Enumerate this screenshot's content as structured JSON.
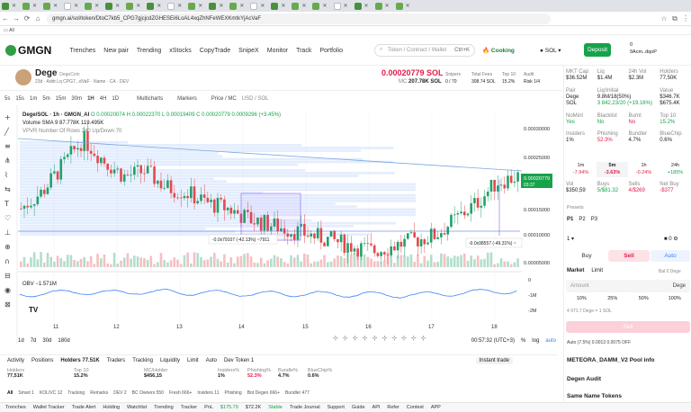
{
  "browser": {
    "url": "gmgn.ai/sol/token/DtoC7kb5_CPG7gjcjcdZGHESEi6LoAL4xqZhNFeWEXKmtkYjAcVaF",
    "bookmarks_label": "All"
  },
  "header": {
    "logo": "GMGN",
    "nav": [
      "Trenches",
      "New pair",
      "Trending",
      "xStocks",
      "CopyTrade",
      "SnipeX",
      "Monitor",
      "Track",
      "Portfolio"
    ],
    "search_placeholder": "Token / Contract / Wallet",
    "search_shortcut": "Ctrl+K",
    "cooking": "Cooking",
    "chain": "SOL",
    "deposit": "Deposit",
    "wallet_balance": "0",
    "wallet_id": "9Acm..dqoP"
  },
  "token": {
    "name": "Dege",
    "fullname": "DegeCoin",
    "age": "23d",
    "address": "Addr.Lq CPG7...dVaF",
    "links": [
      "Name",
      "CA",
      "DEV"
    ],
    "price": "0.00020779 SOL",
    "mc_label": "MC",
    "mc": "207.78K SOL",
    "stats": [
      {
        "label": "Snipers",
        "value": "0 / 70"
      },
      {
        "label": "Total Fees",
        "value": "308.74 SOL"
      },
      {
        "label": "Top 10",
        "value": "15.2%"
      },
      {
        "label": "Audit",
        "value": "Risk 1/4"
      }
    ]
  },
  "chart_toolbar": [
    "5s",
    "15s",
    "1m",
    "5m",
    "15m",
    "30m",
    "1H",
    "4H",
    "1D",
    "Multicharts",
    "Markers",
    "Price / MC",
    "USD / SOL"
  ],
  "chart_legend": {
    "title": "Dege/SOL · 1h · GMGN_AI",
    "ohlc": "O 0.00020074  H 0.00022370  L 0.00019409  C 0.00020779  0.0009296 (+3.45%)",
    "volume": "Volume SMA 9  87.778K  119.495K",
    "vpvr": "VPVR Number Of Rows 240 Up/Down 70",
    "obv": "OBV  −1.571M"
  },
  "chart_data": {
    "type": "candlestick",
    "title": "Dege/SOL · 1h",
    "x_ticks": [
      "11",
      "12",
      "13",
      "14",
      "15",
      "16",
      "17",
      "18"
    ],
    "y_ticks": [
      "0.00030000",
      "0.00025000",
      "0.00020000",
      "0.00015000",
      "0.00010000",
      "0.00005000"
    ],
    "ylim": [
      4e-05,
      0.00033
    ],
    "last_price_label": "0.00020779",
    "last_time_label": "03:37",
    "annotations": [
      "-0.0x79107 (-42.13%) ~7911",
      "-0.0x98557 (-49.31%) ~"
    ],
    "obv_ticks": [
      "0",
      "-1M",
      "-2M"
    ],
    "close_path": [
      0.00015,
      0.00018,
      0.00023,
      0.00028,
      0.00024,
      0.00021,
      0.00022,
      0.00019,
      0.00018,
      0.00016,
      0.00015,
      0.00013,
      0.00012,
      0.00011,
      0.0001,
      9e-05,
      8e-05,
      7e-05,
      8e-05,
      9e-05,
      0.0001,
      0.00013,
      0.00016,
      0.0002,
      0.00021
    ]
  },
  "chart_footer": {
    "ranges": [
      "1d",
      "7d",
      "30d",
      "180d"
    ],
    "clock": "00:57:32 (UTC+3)",
    "scale": [
      "%",
      "log",
      "auto"
    ]
  },
  "bottom": {
    "tabs": [
      "Activity",
      "Positions",
      "Holders 77.51K",
      "Traders",
      "Tracking",
      "Liquidity",
      "Limit",
      "Auto",
      "Dev Token 1"
    ],
    "instant_trade": "Instant trade",
    "stats": [
      {
        "label": "Holders",
        "value": "77,51K"
      },
      {
        "label": "Top 10",
        "value": "15.2%"
      },
      {
        "label": "MC/Holder",
        "value": "$456,15"
      },
      {
        "label": "Insiders%",
        "value": "1%"
      },
      {
        "label": "Phishing%",
        "value": "52.3%"
      },
      {
        "label": "Bundle%",
        "value": "4.7%"
      },
      {
        "label": "BlueChip%",
        "value": "0.6%"
      }
    ],
    "filters": [
      "All",
      "Smart 1",
      "KOL/VC 12",
      "Tracking",
      "Remarks",
      "DEV 2",
      "BC Owners 550",
      "Fresh 666+",
      "Insiders 11",
      "Phishing",
      "Bot Degen 666+",
      "Bundler 477"
    ]
  },
  "statusbar": [
    "Trenches",
    "Wallet Tracker",
    "Trade Alert",
    "Holding",
    "Watchlist",
    "Trending",
    "Tracker",
    "PnL",
    "$175.79",
    "$72.2K",
    "Stable",
    "Trade Journal",
    "Support",
    "Guide",
    "API",
    "Refer",
    "Contest",
    "APP"
  ],
  "right": {
    "metrics_row1": [
      {
        "l": "MKT Cap",
        "v": "$36.52M"
      },
      {
        "l": "Liq",
        "v": "$1.4M"
      },
      {
        "l": "24h Vol",
        "v": "$2.3M"
      },
      {
        "l": "Holders",
        "v": "77,50K"
      }
    ],
    "metrics_row2": [
      {
        "l": "Pair",
        "v": "Dege"
      },
      {
        "l": "Liq/Initial",
        "v": "9.8M/18(50%)"
      },
      {
        "l": "",
        "v": ""
      },
      {
        "l": "Value",
        "v": "$346.7K"
      }
    ],
    "metrics_row3": [
      {
        "l": "",
        "v": "SOL"
      },
      {
        "l": "",
        "v": "3 842,23/20 (+19.16%)"
      },
      {
        "l": "",
        "v": ""
      },
      {
        "l": "",
        "v": "$675.4K"
      }
    ],
    "audit_row1": [
      {
        "l": "NoMint",
        "v": "Yes"
      },
      {
        "l": "Blacklist",
        "v": "No"
      },
      {
        "l": "Burnt",
        "v": "No"
      },
      {
        "l": "Top 10",
        "v": "15.2%"
      }
    ],
    "audit_row2": [
      {
        "l": "Insiders",
        "v": "1%"
      },
      {
        "l": "Phishing",
        "v": "52.3%"
      },
      {
        "l": "Bundler",
        "v": "4.7%"
      },
      {
        "l": "BlueChip",
        "v": "0.6%"
      }
    ],
    "timeframes": [
      {
        "l": "1m",
        "v": "-7.94%"
      },
      {
        "l": "5m",
        "v": "-3.63%"
      },
      {
        "l": "1h",
        "v": "-0.24%"
      },
      {
        "l": "24h",
        "v": "+185%"
      }
    ],
    "vol_row": [
      {
        "l": "Vol",
        "v": "$350,59"
      },
      {
        "l": "Buys",
        "v": "5/$81.32"
      },
      {
        "l": "Sells",
        "v": "4/$269"
      },
      {
        "l": "Net Buy",
        "v": "-$377"
      }
    ],
    "presets_label": "Presets",
    "presets": [
      "P1",
      "P2",
      "P3"
    ],
    "qty": "1",
    "buy": "Buy",
    "sell": "Sell",
    "auto": "Auto",
    "market": "Market",
    "limit": "Limit",
    "bal": "Bal 0 Dege",
    "amount_placeholder": "Amount",
    "amount_unit": "Dege",
    "pcts": [
      "10%",
      "25%",
      "50%",
      "100%"
    ],
    "rate": "4 971.7 Dege = 1 SOL",
    "sell_button": "Sell",
    "auto_row": "Auto (7.5%)   0.0013   0.0075   OFF",
    "pool": "METEORA_DAMM_V2 Pool info",
    "audit": "Degen Audit",
    "same_name": "Same Name Tokens"
  }
}
